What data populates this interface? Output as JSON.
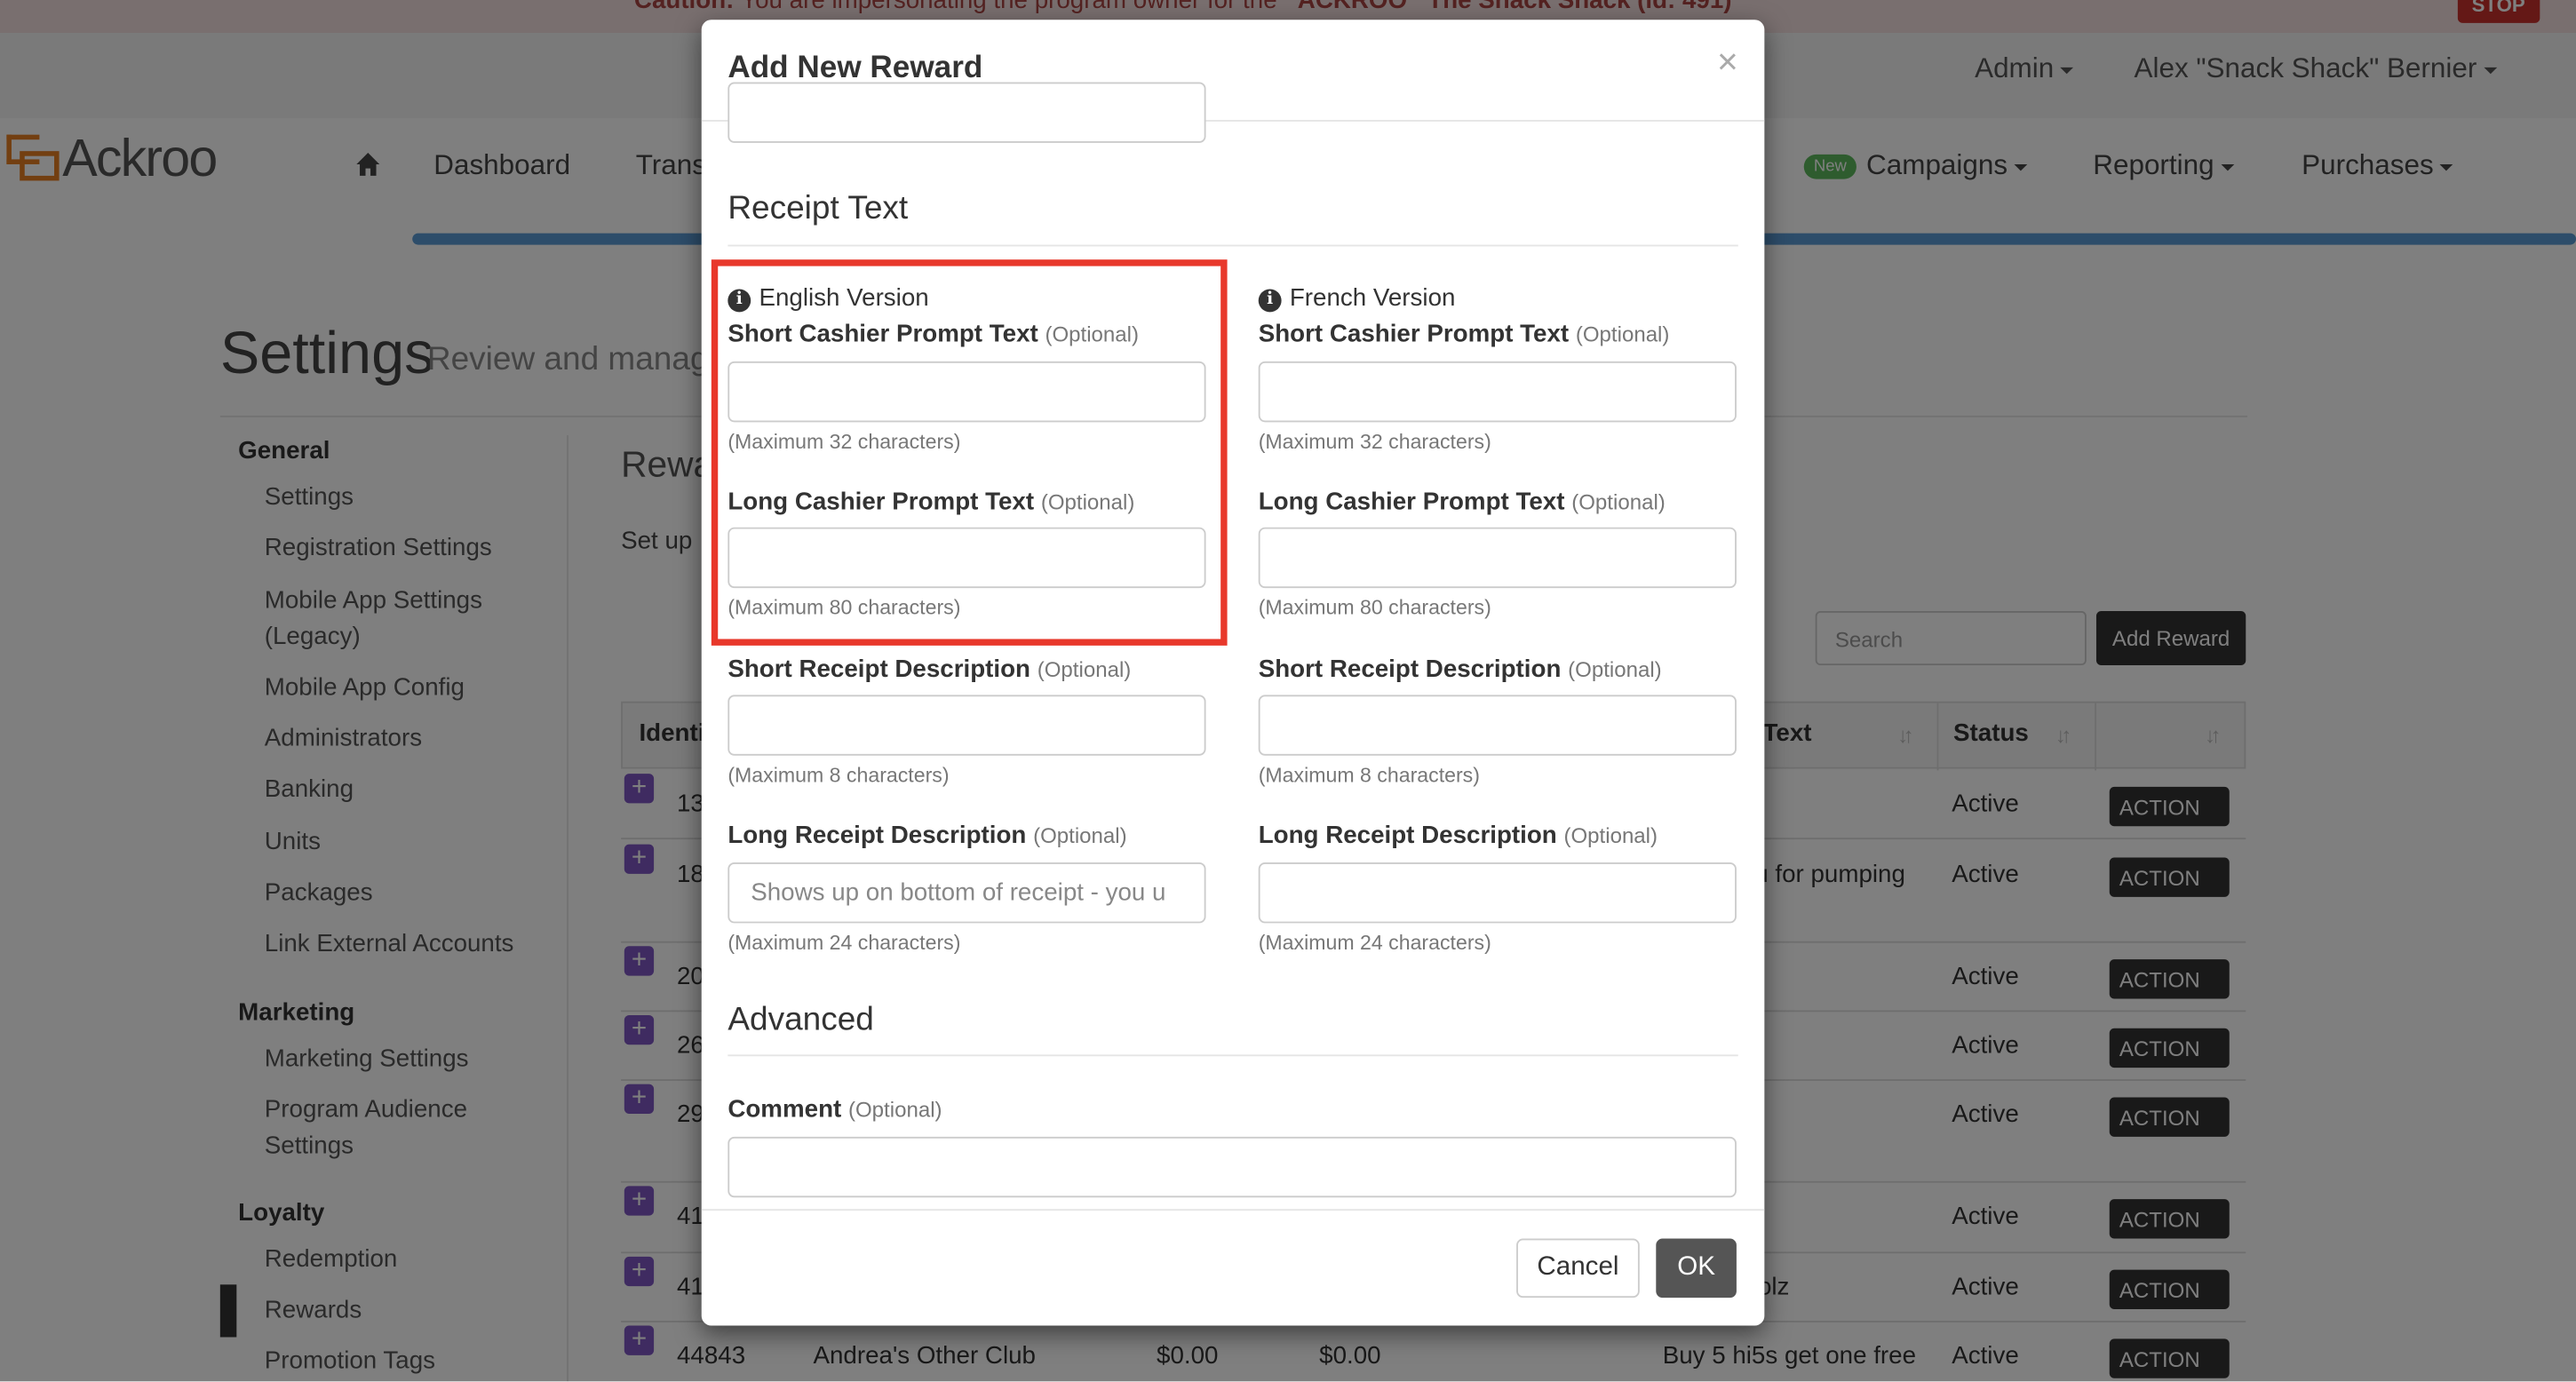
{
  "caution": {
    "bold": "Caution:",
    "text": "You are impersonating the program owner for the",
    "program": "ACKROO",
    "brand": "The Snack Shack (id: 491)",
    "stop": "STOP"
  },
  "topbar": {
    "admin": "Admin",
    "user": "Alex \"Snack Shack\" Bernier"
  },
  "logo": "Ackroo",
  "nav": {
    "dashboard": "Dashboard",
    "transactions": "Trans",
    "new_badge": "New",
    "campaigns": "Campaigns",
    "reporting": "Reporting",
    "purchases": "Purchases"
  },
  "settings": {
    "title": "Settings",
    "subtitle": "Review and manag"
  },
  "sidebar": {
    "general": "General",
    "general_items": [
      "Settings",
      "Registration Settings",
      "Mobile App Settings",
      "(Legacy)",
      "Mobile App Config",
      "Administrators",
      "Banking",
      "Units",
      "Packages",
      "Link External Accounts"
    ],
    "marketing": "Marketing",
    "marketing_items": [
      "Marketing Settings",
      "Program Audience",
      "Settings"
    ],
    "loyalty": "Loyalty",
    "loyalty_items": [
      "Redemption",
      "Rewards",
      "Promotion Tags"
    ]
  },
  "rewards": {
    "heading": "Rewa",
    "setup": "Set up",
    "search_placeholder": "Search",
    "add_button": "Add Reward"
  },
  "table": {
    "headers": {
      "ident": "Identi",
      "text": "Text",
      "status": "Status"
    },
    "rows": [
      {
        "id": "13",
        "text": "",
        "status": "Active",
        "action": "ACTION"
      },
      {
        "id": "18",
        "text": "u for pumping",
        "status": "Active",
        "action": "ACTION"
      },
      {
        "id": "20",
        "text": "",
        "status": "Active",
        "action": "ACTION"
      },
      {
        "id": "26",
        "text": "",
        "status": "Active",
        "action": "ACTION"
      },
      {
        "id": "29",
        "text": "",
        "status": "Active",
        "action": "ACTION"
      },
      {
        "id": "41",
        "text": "",
        "status": "Active",
        "action": "ACTION"
      },
      {
        "id": "41",
        "text": "olz",
        "status": "Active",
        "action": "ACTION"
      },
      {
        "id": "44843",
        "name": "Andrea's Other Club",
        "v1": "$0.00",
        "v2": "$0.00",
        "text": "Buy 5 hi5s get one free",
        "status": "Active",
        "action": "ACTION"
      }
    ]
  },
  "modal": {
    "title": "Add New Reward",
    "close": "×",
    "receipt_section": "Receipt Text",
    "english": "English Version",
    "french": "French Version",
    "optional": "(Optional)",
    "short_cashier": "Short Cashier Prompt Text",
    "short_cashier_help": "(Maximum 32 characters)",
    "long_cashier": "Long Cashier Prompt Text",
    "long_cashier_help": "(Maximum 80 characters)",
    "short_receipt": "Short Receipt Description",
    "short_receipt_help": "(Maximum 8 characters)",
    "long_receipt": "Long Receipt Description",
    "long_receipt_help": "(Maximum 24 characters)",
    "long_receipt_placeholder": "Shows up on bottom of receipt - you u",
    "advanced_section": "Advanced",
    "comment": "Comment",
    "cancel": "Cancel",
    "ok": "OK"
  }
}
